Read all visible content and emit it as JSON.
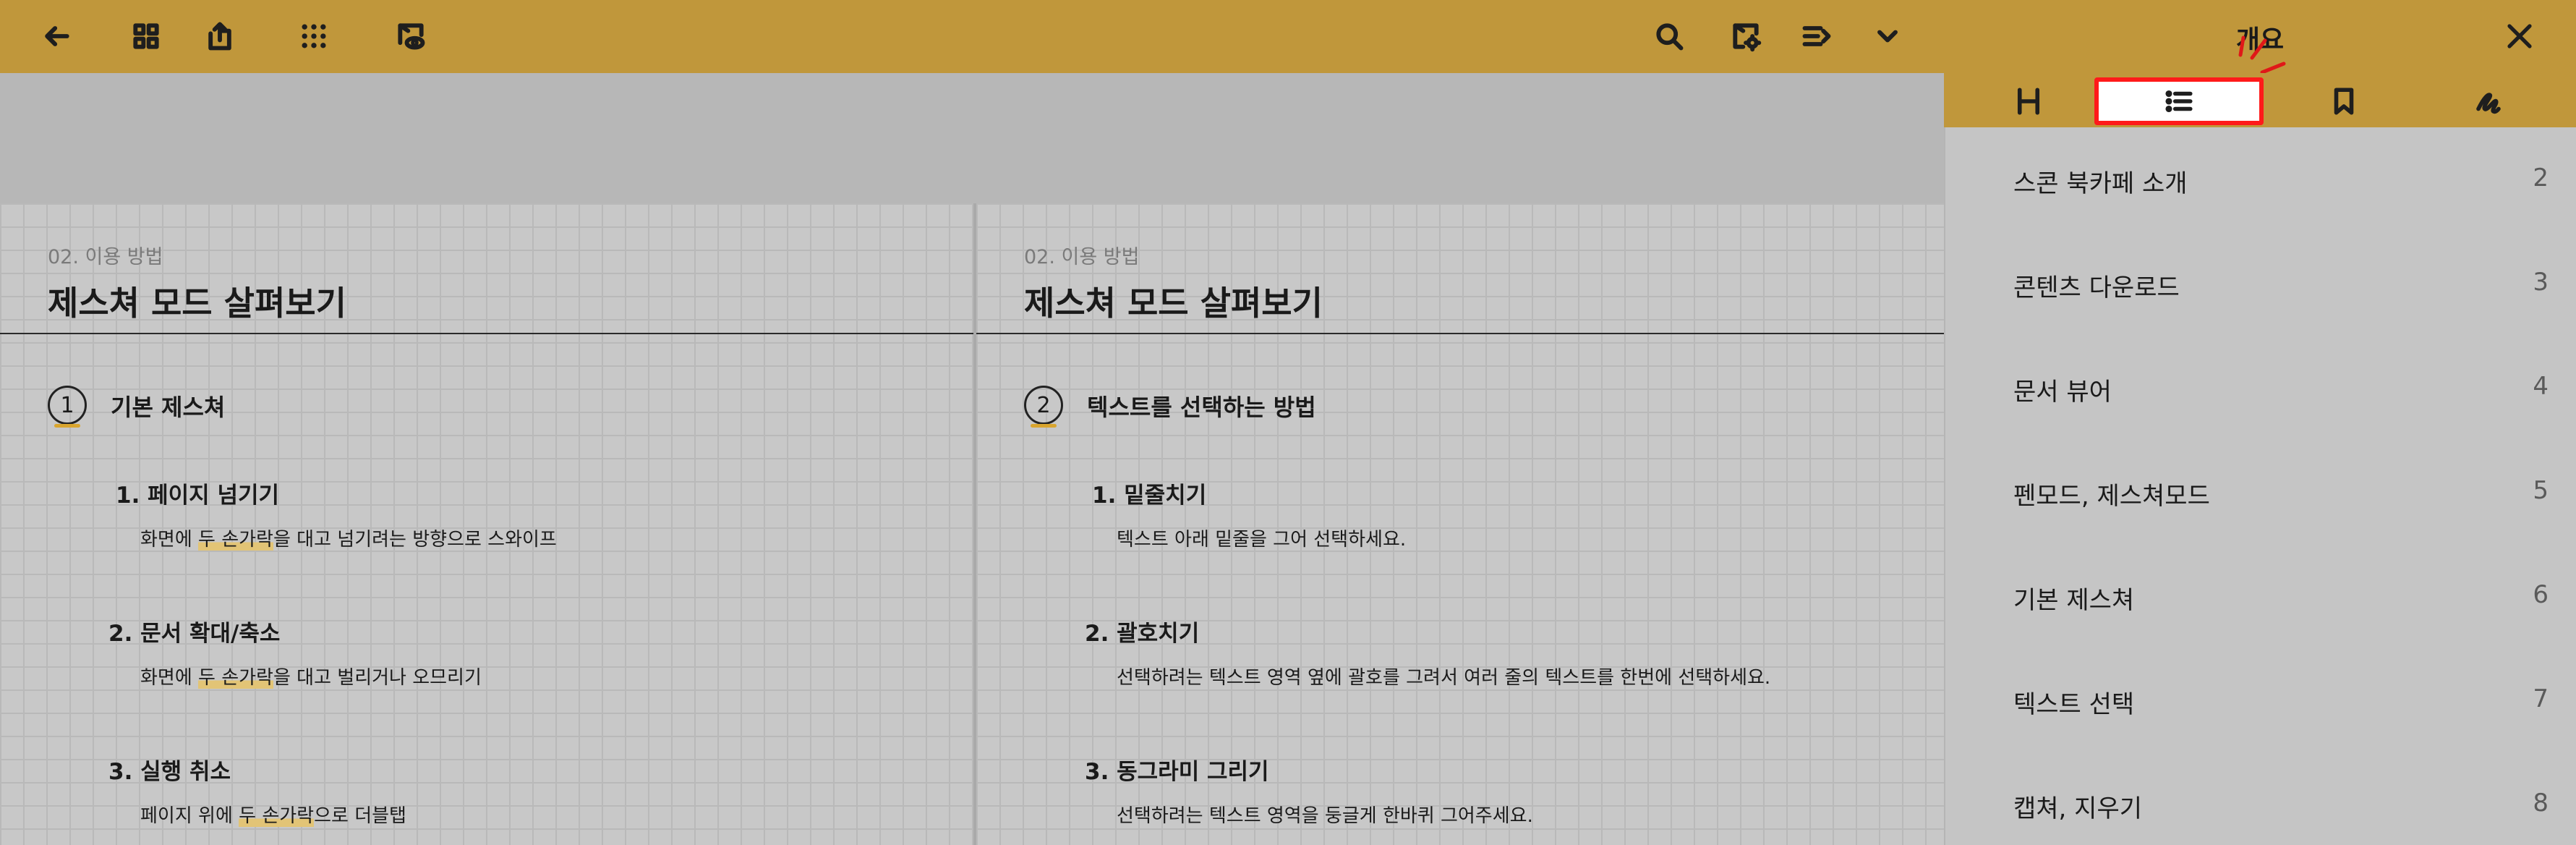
{
  "toolbar": {
    "left_icons": [
      "back-arrow-icon",
      "grid-view-icon",
      "share-upload-icon",
      "apps-dots-icon",
      "view-mode-icon"
    ],
    "right_icons": [
      "search-icon",
      "document-settings-icon",
      "reading-mode-icon",
      "chevron-down-icon"
    ]
  },
  "pages": [
    {
      "breadcrumb": "02. 이용 방법",
      "title": "제스쳐 모드 살펴보기",
      "section": {
        "number": "1",
        "title": "기본 제스쳐"
      },
      "items": [
        {
          "heading": "1. 페이지 넘기기",
          "desc_pre": "화면에 ",
          "desc_hl": "두 손가락",
          "desc_post": "을 대고 넘기려는 방향으로 스와이프"
        },
        {
          "heading": "2. 문서 확대/축소",
          "desc_pre": "화면에 ",
          "desc_hl": "두 손가락",
          "desc_post": "을 대고 벌리거나 오므리기"
        },
        {
          "heading": "3. 실행 취소",
          "desc_pre": "페이지 위에 ",
          "desc_hl": "두 손가락",
          "desc_post": "으로 더블탭"
        }
      ]
    },
    {
      "breadcrumb": "02. 이용 방법",
      "title": "제스쳐 모드 살펴보기",
      "section": {
        "number": "2",
        "title": "텍스트를 선택하는 방법"
      },
      "items": [
        {
          "heading": "1. 밑줄치기",
          "desc": "텍스트 아래 밑줄을 그어 선택하세요."
        },
        {
          "heading": "2. 괄호치기",
          "desc": "선택하려는 텍스트 영역 옆에 괄호를 그려서 여러 줄의 텍스트를 한번에 선택하세요."
        },
        {
          "heading": "3. 동그라미 그리기",
          "desc": "선택하려는 텍스트 영역을 둥글게 한바퀴 그어주세요."
        }
      ]
    }
  ],
  "panel": {
    "title": "개요",
    "close_icon": "close-icon",
    "tabs": [
      {
        "icon": "thumbnails-icon",
        "selected": false
      },
      {
        "icon": "outline-list-icon",
        "selected": true
      },
      {
        "icon": "bookmark-icon",
        "selected": false
      },
      {
        "icon": "annotations-pen-icon",
        "selected": false
      }
    ],
    "outline": [
      {
        "label": "스콘 북카페 소개",
        "page": "2"
      },
      {
        "label": "콘텐츠 다운로드",
        "page": "3"
      },
      {
        "label": "문서 뷰어",
        "page": "4"
      },
      {
        "label": "펜모드, 제스쳐모드",
        "page": "5"
      },
      {
        "label": "기본 제스쳐",
        "page": "6"
      },
      {
        "label": "텍스트 선택",
        "page": "7"
      },
      {
        "label": "캡쳐, 지우기",
        "page": "8"
      }
    ]
  },
  "colors": {
    "accent": "#c0973b",
    "highlight_border": "#ff1a1a",
    "page_bg": "#c8c8c8"
  }
}
